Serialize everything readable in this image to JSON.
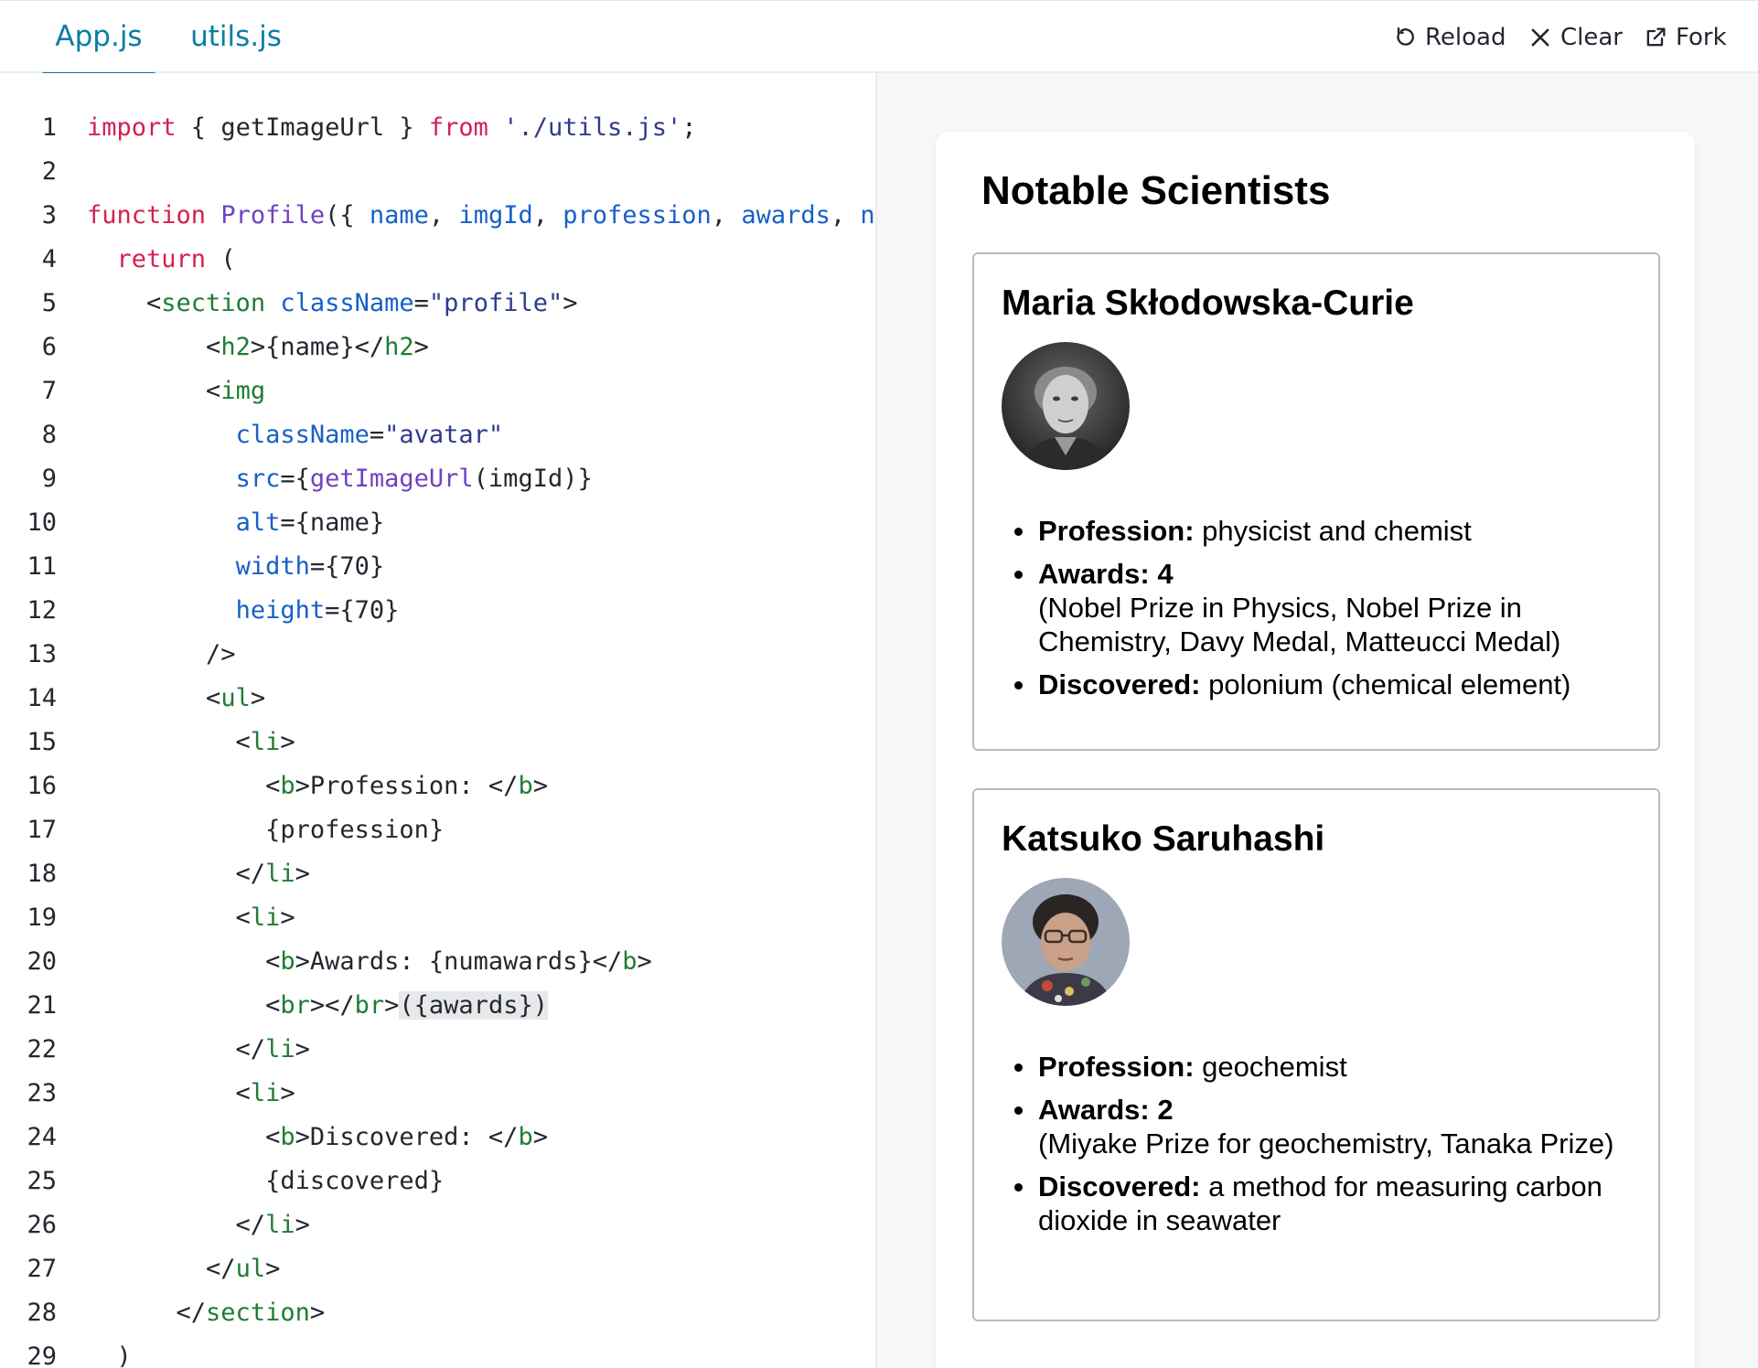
{
  "tabs": [
    {
      "label": "App.js",
      "active": true
    },
    {
      "label": "utils.js",
      "active": false
    }
  ],
  "toolbar": {
    "reload_label": "Reload",
    "clear_label": "Clear",
    "fork_label": "Fork"
  },
  "editor": {
    "lines": [
      {
        "num": "1",
        "tokens": [
          {
            "t": "kw",
            "v": "import"
          },
          {
            "t": "pl",
            "v": " { getImageUrl } "
          },
          {
            "t": "kw",
            "v": "from"
          },
          {
            "t": "pl",
            "v": " "
          },
          {
            "t": "str",
            "v": "'./utils.js'"
          },
          {
            "t": "pl",
            "v": ";"
          }
        ]
      },
      {
        "num": "2",
        "tokens": []
      },
      {
        "num": "3",
        "tokens": [
          {
            "t": "kw",
            "v": "function"
          },
          {
            "t": "pl",
            "v": " "
          },
          {
            "t": "fn",
            "v": "Profile"
          },
          {
            "t": "pl",
            "v": "({ "
          },
          {
            "t": "prop",
            "v": "name"
          },
          {
            "t": "pl",
            "v": ", "
          },
          {
            "t": "prop",
            "v": "imgId"
          },
          {
            "t": "pl",
            "v": ", "
          },
          {
            "t": "prop",
            "v": "profession"
          },
          {
            "t": "pl",
            "v": ", "
          },
          {
            "t": "prop",
            "v": "awards"
          },
          {
            "t": "pl",
            "v": ", "
          },
          {
            "t": "prop",
            "v": "n"
          }
        ]
      },
      {
        "num": "4",
        "tokens": [
          {
            "t": "pl",
            "v": "  "
          },
          {
            "t": "kw",
            "v": "return"
          },
          {
            "t": "pl",
            "v": " ("
          }
        ]
      },
      {
        "num": "5",
        "tokens": [
          {
            "t": "pl",
            "v": "    <"
          },
          {
            "t": "tag",
            "v": "section"
          },
          {
            "t": "pl",
            "v": " "
          },
          {
            "t": "prop",
            "v": "className"
          },
          {
            "t": "pl",
            "v": "="
          },
          {
            "t": "str",
            "v": "\"profile\""
          },
          {
            "t": "pl",
            "v": ">"
          }
        ]
      },
      {
        "num": "6",
        "tokens": [
          {
            "t": "pl",
            "v": "        <"
          },
          {
            "t": "tag",
            "v": "h2"
          },
          {
            "t": "pl",
            "v": ">{name}</"
          },
          {
            "t": "tag",
            "v": "h2"
          },
          {
            "t": "pl",
            "v": ">"
          }
        ]
      },
      {
        "num": "7",
        "tokens": [
          {
            "t": "pl",
            "v": "        <"
          },
          {
            "t": "tag",
            "v": "img"
          }
        ]
      },
      {
        "num": "8",
        "tokens": [
          {
            "t": "pl",
            "v": "          "
          },
          {
            "t": "prop",
            "v": "className"
          },
          {
            "t": "pl",
            "v": "="
          },
          {
            "t": "str",
            "v": "\"avatar\""
          }
        ]
      },
      {
        "num": "9",
        "tokens": [
          {
            "t": "pl",
            "v": "          "
          },
          {
            "t": "prop",
            "v": "src"
          },
          {
            "t": "pl",
            "v": "={"
          },
          {
            "t": "fn",
            "v": "getImageUrl"
          },
          {
            "t": "pl",
            "v": "(imgId)}"
          }
        ]
      },
      {
        "num": "10",
        "tokens": [
          {
            "t": "pl",
            "v": "          "
          },
          {
            "t": "prop",
            "v": "alt"
          },
          {
            "t": "pl",
            "v": "={name}"
          }
        ]
      },
      {
        "num": "11",
        "tokens": [
          {
            "t": "pl",
            "v": "          "
          },
          {
            "t": "prop",
            "v": "width"
          },
          {
            "t": "pl",
            "v": "={70}"
          }
        ]
      },
      {
        "num": "12",
        "tokens": [
          {
            "t": "pl",
            "v": "          "
          },
          {
            "t": "prop",
            "v": "height"
          },
          {
            "t": "pl",
            "v": "={70}"
          }
        ]
      },
      {
        "num": "13",
        "tokens": [
          {
            "t": "pl",
            "v": "        />"
          }
        ]
      },
      {
        "num": "14",
        "tokens": [
          {
            "t": "pl",
            "v": "        <"
          },
          {
            "t": "tag",
            "v": "ul"
          },
          {
            "t": "pl",
            "v": ">"
          }
        ]
      },
      {
        "num": "15",
        "tokens": [
          {
            "t": "pl",
            "v": "          <"
          },
          {
            "t": "tag",
            "v": "li"
          },
          {
            "t": "pl",
            "v": ">"
          }
        ]
      },
      {
        "num": "16",
        "tokens": [
          {
            "t": "pl",
            "v": "            <"
          },
          {
            "t": "tag",
            "v": "b"
          },
          {
            "t": "pl",
            "v": ">Profession: </"
          },
          {
            "t": "tag",
            "v": "b"
          },
          {
            "t": "pl",
            "v": ">"
          }
        ]
      },
      {
        "num": "17",
        "tokens": [
          {
            "t": "pl",
            "v": "            {profession}"
          }
        ]
      },
      {
        "num": "18",
        "tokens": [
          {
            "t": "pl",
            "v": "          </"
          },
          {
            "t": "tag",
            "v": "li"
          },
          {
            "t": "pl",
            "v": ">"
          }
        ]
      },
      {
        "num": "19",
        "tokens": [
          {
            "t": "pl",
            "v": "          <"
          },
          {
            "t": "tag",
            "v": "li"
          },
          {
            "t": "pl",
            "v": ">"
          }
        ]
      },
      {
        "num": "20",
        "tokens": [
          {
            "t": "pl",
            "v": "            <"
          },
          {
            "t": "tag",
            "v": "b"
          },
          {
            "t": "pl",
            "v": ">Awards: {numawards}</"
          },
          {
            "t": "tag",
            "v": "b"
          },
          {
            "t": "pl",
            "v": ">"
          }
        ]
      },
      {
        "num": "21",
        "tokens": [
          {
            "t": "pl",
            "v": "            <"
          },
          {
            "t": "tag",
            "v": "br"
          },
          {
            "t": "pl",
            "v": "></"
          },
          {
            "t": "tag",
            "v": "br"
          },
          {
            "t": "pl",
            "v": ">"
          },
          {
            "t": "hl",
            "v": "({awards})"
          }
        ]
      },
      {
        "num": "22",
        "tokens": [
          {
            "t": "pl",
            "v": "          </"
          },
          {
            "t": "tag",
            "v": "li"
          },
          {
            "t": "pl",
            "v": ">"
          }
        ]
      },
      {
        "num": "23",
        "tokens": [
          {
            "t": "pl",
            "v": "          <"
          },
          {
            "t": "tag",
            "v": "li"
          },
          {
            "t": "pl",
            "v": ">"
          }
        ]
      },
      {
        "num": "24",
        "tokens": [
          {
            "t": "pl",
            "v": "            <"
          },
          {
            "t": "tag",
            "v": "b"
          },
          {
            "t": "pl",
            "v": ">Discovered: </"
          },
          {
            "t": "tag",
            "v": "b"
          },
          {
            "t": "pl",
            "v": ">"
          }
        ]
      },
      {
        "num": "25",
        "tokens": [
          {
            "t": "pl",
            "v": "            {discovered}"
          }
        ]
      },
      {
        "num": "26",
        "tokens": [
          {
            "t": "pl",
            "v": "          </"
          },
          {
            "t": "tag",
            "v": "li"
          },
          {
            "t": "pl",
            "v": ">"
          }
        ]
      },
      {
        "num": "27",
        "tokens": [
          {
            "t": "pl",
            "v": "        </"
          },
          {
            "t": "tag",
            "v": "ul"
          },
          {
            "t": "pl",
            "v": ">"
          }
        ]
      },
      {
        "num": "28",
        "tokens": [
          {
            "t": "pl",
            "v": "      </"
          },
          {
            "t": "tag",
            "v": "section"
          },
          {
            "t": "pl",
            "v": ">"
          }
        ]
      },
      {
        "num": "29",
        "tokens": [
          {
            "t": "pl",
            "v": "  )"
          }
        ]
      }
    ]
  },
  "preview": {
    "title": "Notable Scientists",
    "profiles": [
      {
        "name": "Maria Skłodowska-Curie",
        "profession_label": "Profession:",
        "profession": "physicist and chemist",
        "awards_label": "Awards: 4",
        "awards": "(Nobel Prize in Physics, Nobel Prize in Chemistry, Davy Medal, Matteucci Medal)",
        "discovered_label": "Discovered:",
        "discovered": "polonium (chemical element)"
      },
      {
        "name": "Katsuko Saruhashi",
        "profession_label": "Profession:",
        "profession": "geochemist",
        "awards_label": "Awards: 2",
        "awards": "(Miyake Prize for geochemistry, Tanaka Prize)",
        "discovered_label": "Discovered:",
        "discovered": "a method for measuring carbon dioxide in seawater"
      }
    ]
  },
  "colors": {
    "accent": "#087ea4",
    "keyword": "#d6204f",
    "function": "#6f42c1",
    "property": "#1760c7",
    "string": "#2f3a8c",
    "tag": "#1e7d32",
    "preview_bg": "#f6f7f9"
  }
}
